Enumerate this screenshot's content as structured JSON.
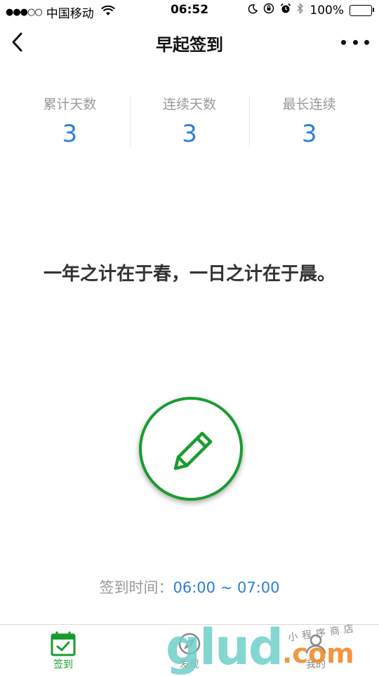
{
  "status_bar": {
    "signal": "●●●○○",
    "carrier": "中国移动",
    "time": "06:52",
    "battery": "100%"
  },
  "nav": {
    "title": "早起签到"
  },
  "stats": [
    {
      "label": "累计天数",
      "value": "3"
    },
    {
      "label": "连续天数",
      "value": "3"
    },
    {
      "label": "最长连续",
      "value": "3"
    }
  ],
  "quote": "一年之计在于春，一日之计在于晨。",
  "checkin": {
    "time_label": "签到时间：",
    "time_range": "06:00 ~ 07:00"
  },
  "tabs": [
    {
      "label": "签到",
      "icon": "calendar-check-icon",
      "active": true
    },
    {
      "label": "发现",
      "icon": "compass-icon",
      "active": false
    },
    {
      "label": "我的",
      "icon": "user-icon",
      "active": false
    }
  ],
  "watermark": {
    "big": "glud",
    "com": ".com",
    "small": "小程序商店"
  },
  "colors": {
    "accent_green": "#1a9b2f",
    "value_blue": "#2f7ed8"
  }
}
